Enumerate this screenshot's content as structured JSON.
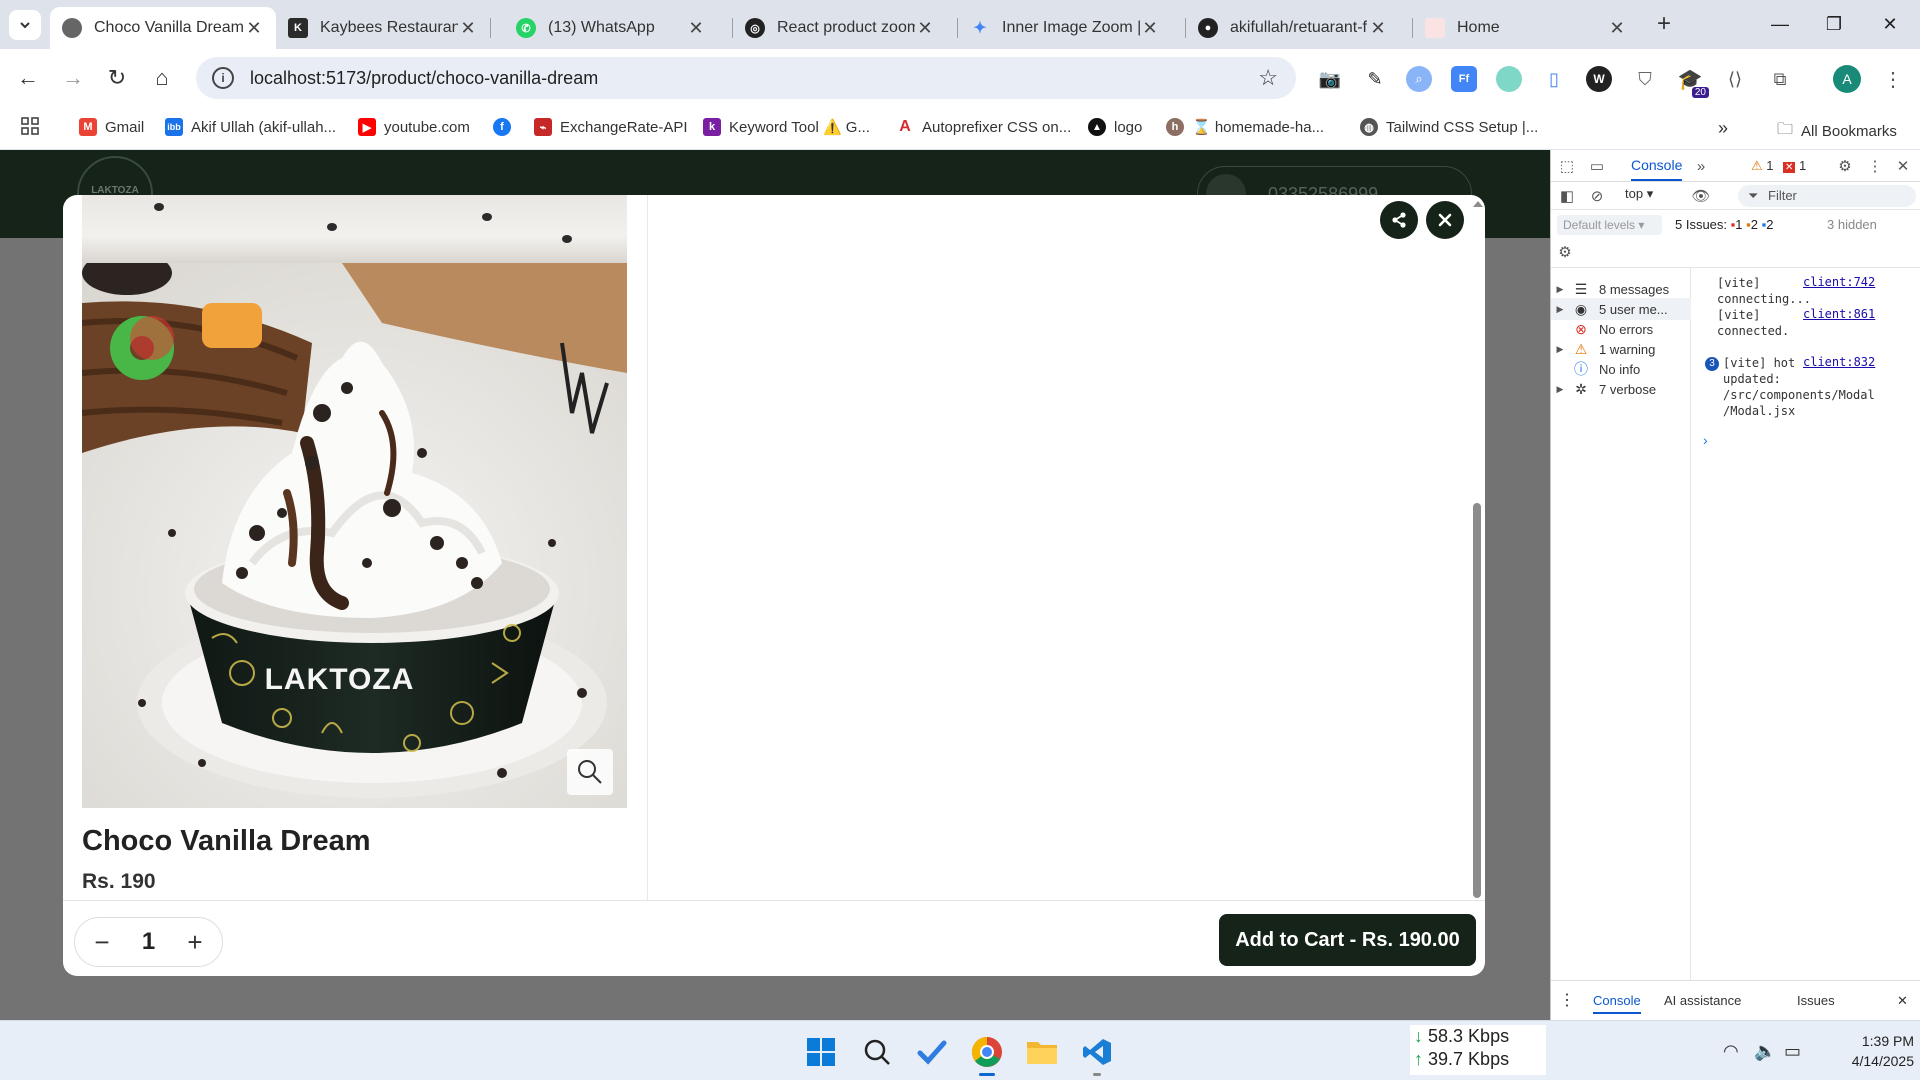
{
  "browser": {
    "tabs": [
      {
        "title": "Choco Vanilla Dream",
        "active": true,
        "favicon": "page-icon",
        "color": "#666666"
      },
      {
        "title": "Kaybees Restaurant |",
        "active": false,
        "favicon": "kaybees-icon",
        "color": "#2b2b2b"
      },
      {
        "title": "(13) WhatsApp",
        "active": false,
        "favicon": "whatsapp-icon",
        "color": "#25d366"
      },
      {
        "title": "React product zoom",
        "active": false,
        "favicon": "chatgpt-icon",
        "color": "#222222"
      },
      {
        "title": "Inner Image Zoom | I",
        "active": false,
        "favicon": "sparkle-icon",
        "color": "#4285f4"
      },
      {
        "title": "akifullah/retuarant-fr",
        "active": false,
        "favicon": "github-icon",
        "color": "#222222"
      },
      {
        "title": "Home",
        "active": false,
        "favicon": "home-page-icon",
        "color": "#e25555"
      }
    ],
    "url": "localhost:5173/product/choco-vanilla-dream",
    "profile_initial": "A",
    "extension_badge": "20",
    "bookmarks": [
      {
        "label": "Gmail",
        "icon": "gmail-icon",
        "color": "#ea4335"
      },
      {
        "label": "Akif Ullah (akif-ullah...",
        "icon": "ibb-icon",
        "color": "#1a73e8"
      },
      {
        "label": "youtube.com",
        "icon": "youtube-icon",
        "color": "#ff0000"
      },
      {
        "label": "",
        "icon": "facebook-icon",
        "color": "#1877f2"
      },
      {
        "label": "ExchangeRate-API",
        "icon": "exchangerate-icon",
        "color": "#c62828"
      },
      {
        "label": "Keyword Tool ⚠️ G...",
        "icon": "keyword-tool-icon",
        "color": "#7b1fa2"
      },
      {
        "label": "Autoprefixer CSS on...",
        "icon": "autoprefixer-icon",
        "color": "#d32f2f"
      },
      {
        "label": "logo",
        "icon": "vercel-icon",
        "color": "#111111"
      },
      {
        "label": "⌛ homemade-ha...",
        "icon": "homemade-icon",
        "color": "#8d6e63"
      },
      {
        "label": "Tailwind CSS Setup |...",
        "icon": "globe-icon",
        "color": "#555555"
      }
    ],
    "all_bookmarks": "All Bookmarks"
  },
  "site": {
    "logo_text": "LAKTOZA",
    "phone": "03352586999"
  },
  "product": {
    "name": "Choco Vanilla Dream",
    "price": "Rs. 190",
    "quantity": "1",
    "add_to_cart": "Add to Cart - Rs. 190.00",
    "cup_brand": "LAKTOZA",
    "minus": "−",
    "plus": "+"
  },
  "devtools": {
    "tab_console": "Console",
    "warn_count": "1",
    "error_count": "1",
    "context": "top",
    "filter_placeholder": "Filter",
    "levels": "Default levels",
    "issues_label": "5 Issues:",
    "issues_counts": [
      "1",
      "2",
      "2"
    ],
    "hidden": "3 hidden",
    "sidebar": [
      {
        "label": "8 messages",
        "icon": "list-icon",
        "expandable": true
      },
      {
        "label": "5 user me...",
        "icon": "user-icon",
        "expandable": true
      },
      {
        "label": "No errors",
        "icon": "error-icon",
        "expandable": false
      },
      {
        "label": "1 warning",
        "icon": "warning-icon",
        "expandable": true
      },
      {
        "label": "No info",
        "icon": "info-icon",
        "expandable": false
      },
      {
        "label": "7 verbose",
        "icon": "bug-icon",
        "expandable": true
      }
    ],
    "logs": [
      {
        "text": "[vite]\nconnecting...",
        "source": "client:742"
      },
      {
        "text": "[vite]\nconnected.",
        "source": "client:861"
      },
      {
        "text": "[vite] hot\nupdated:\n/src/components/Modal\n/Modal.jsx",
        "source": "client:832",
        "count": "3"
      }
    ],
    "bottom_tabs": [
      "Console",
      "AI assistance",
      "Issues"
    ]
  },
  "taskbar": {
    "net_down": "58.3 Kbps",
    "net_up": "39.7 Kbps",
    "time": "1:39 PM",
    "date": "4/14/2025"
  }
}
